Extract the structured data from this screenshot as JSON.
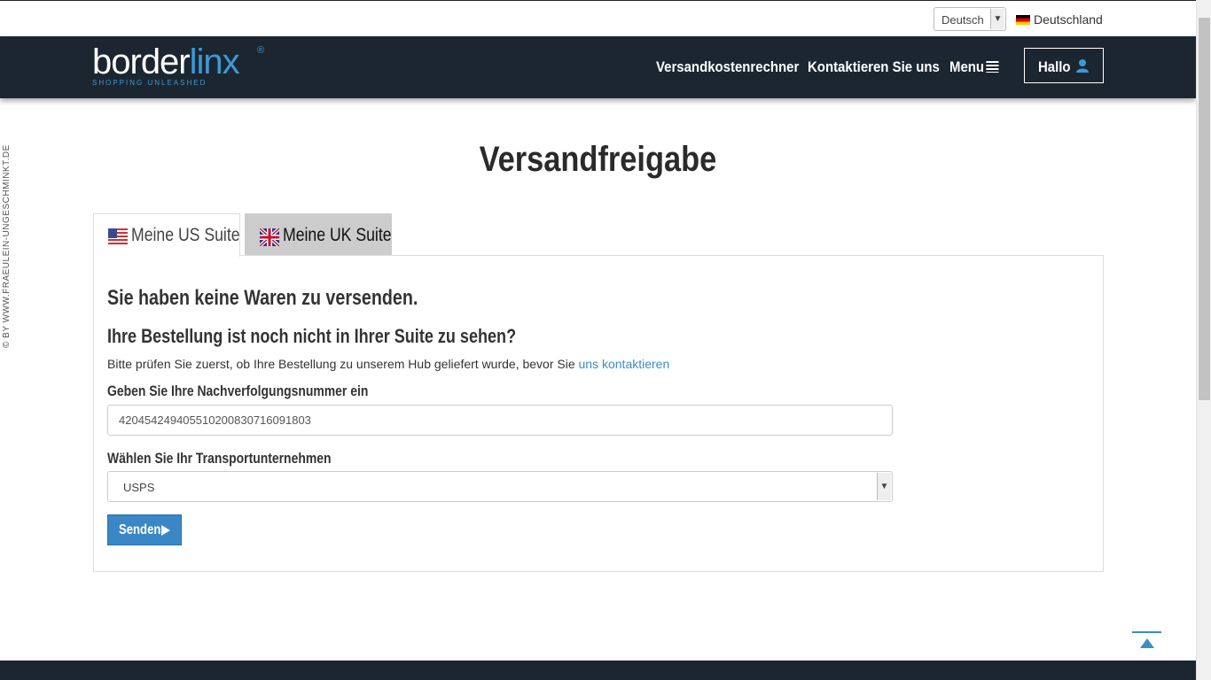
{
  "topbar": {
    "language_value": "Deutsch",
    "country_label": "Deutschland"
  },
  "header": {
    "logo_main": "border",
    "logo_accent": "linx",
    "logo_reg": "®",
    "logo_tagline": "SHOPPING UNLEASHED",
    "nav": [
      "Versandkostenrechner",
      "Kontaktieren Sie uns",
      "Menu"
    ],
    "user_button_label": "Hallo"
  },
  "watermark": "© BY WWW.FRAEULEIN-UNGESCHMINKT.DE",
  "page": {
    "title": "Versandfreigabe",
    "tabs": [
      {
        "label": "Meine US Suite",
        "active": true
      },
      {
        "label": "Meine UK Suite",
        "active": false
      }
    ],
    "panel": {
      "no_items_heading": "Sie haben keine Waren zu versenden.",
      "order_heading": "Ihre Bestellung ist noch nicht in Ihrer Suite zu sehen?",
      "info_text": "Bitte prüfen Sie zuerst, ob Ihre Bestellung zu unserem Hub geliefert wurde, bevor Sie ",
      "info_link": "uns kontaktieren",
      "tracking_label": "Geben Sie Ihre Nachverfolgungsnummer ein",
      "tracking_value": "420454249405510200830716091803",
      "carrier_label": "Wählen Sie Ihr Transportunternehmen",
      "carrier_value": "USPS",
      "submit_label": "Senden"
    }
  },
  "colors": {
    "header_bg": "#1c2631",
    "accent": "#3c9ad8",
    "button_bg": "#3b87c5"
  }
}
